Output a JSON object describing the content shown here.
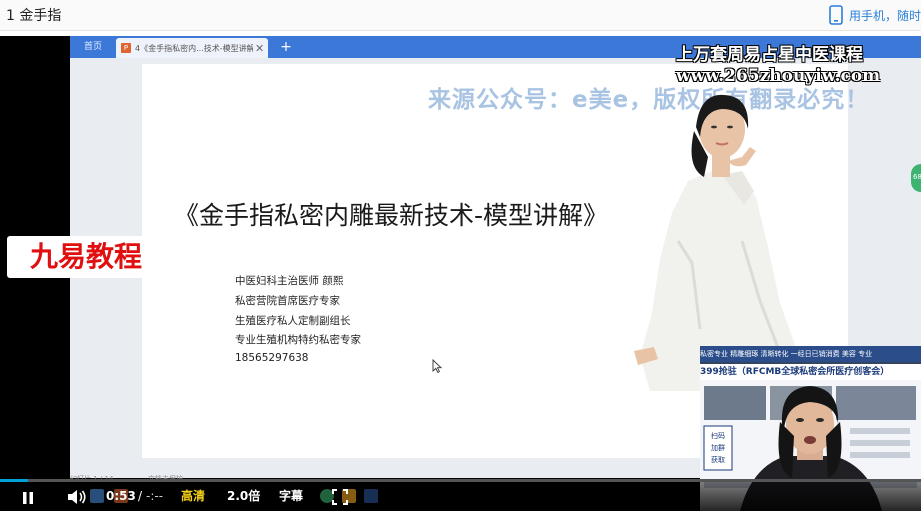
{
  "header": {
    "title": "1 金手指",
    "mobile_label": "用手机，随时"
  },
  "browser": {
    "home_tab": "首页",
    "doc_tab_icon": "P",
    "doc_tab": "4《金手指私密内...技术-模型讲解》",
    "close_glyph": "✕",
    "add_glyph": "+"
  },
  "slide": {
    "watermark": "来源公众号：e美e，版权所有翻录必究！",
    "title": "《金手指私密内雕最新技术-模型讲解》",
    "lines": [
      "中医妇科主治医师  颜熙",
      "私密营院首席医疗专家",
      "生殖医疗私人定制副组长",
      "专业生殖机构特约私密专家",
      "18565297638"
    ]
  },
  "status_bar": {
    "pages": "幻灯片 1 / 14",
    "doc": "文档未保护"
  },
  "overlay": {
    "brand": "九易教程",
    "ad_line1": "上万套周易占星中医课程",
    "ad_line2": "www.265zhouyiw.com",
    "side_badge": "68"
  },
  "webcam": {
    "banner": "私密专业 精雕细琢 清晰转化 一经日已销消费 美容 专业",
    "board_title": "399抢驻（RFCMB全球私密会所医疗创客会）",
    "board_box": [
      "扫码",
      "加群",
      "获取"
    ]
  },
  "player": {
    "progress": 0.03,
    "current_time": "0:53",
    "separator": "/",
    "duration": "-:--",
    "quality": "高清",
    "speed": "2.0倍",
    "subtitle": "字幕"
  },
  "colors": {
    "accent": "#00a1d6",
    "quality": "#f5d21a",
    "brand_red": "#e01010",
    "watermark": "#a9c4e3"
  }
}
